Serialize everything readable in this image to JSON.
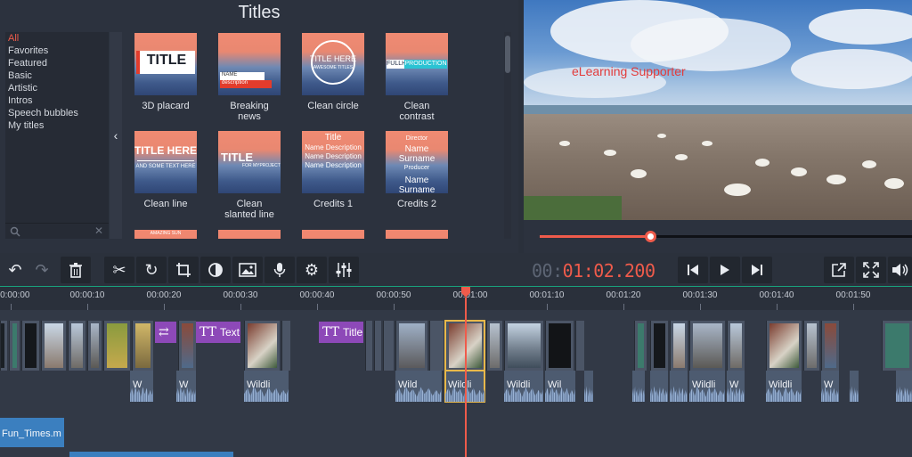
{
  "titles_panel": {
    "heading": "Titles",
    "categories": [
      "All",
      "Favorites",
      "Featured",
      "Basic",
      "Artistic",
      "Intros",
      "Speech bubbles",
      "My titles"
    ],
    "tiles": [
      {
        "label": "3D placard",
        "art_text": "TITLE",
        "sub_text": ""
      },
      {
        "label": "Breaking\nnews",
        "art_text": "NAME",
        "sub_text": "description"
      },
      {
        "label": "Clean circle",
        "art_text": "TITLE HERE",
        "sub_text": "AWESOME TITLES"
      },
      {
        "label": "Clean\ncontrast",
        "art_text": "FULLHD",
        "sub_text": "PRODUCTION"
      },
      {
        "label": "Clean line",
        "art_text": "TITLE HERE",
        "sub_text": "AND SOME TEXT HERE"
      },
      {
        "label": "Clean\nslanted line",
        "art_text": "TITLE",
        "sub_text": "FOR MYPROJECT"
      },
      {
        "label": "Credits 1",
        "art_text": "Title",
        "sub_text": "Name Description"
      },
      {
        "label": "Credits 2",
        "art_text": "Director",
        "sub_text": "Name Surname"
      }
    ],
    "credits1_lines": [
      "Title",
      "Name Description",
      "Name Description",
      "Name Description"
    ],
    "credits2_lines": [
      "Director",
      "Name Surname",
      "Producer",
      "Name Surname"
    ],
    "peek_tile_text": "AMAZING SUN"
  },
  "preview": {
    "watermark": "eLearning Supporter",
    "progress": 0.297
  },
  "timecode": {
    "dim": "00:",
    "hot": "01:02.200"
  },
  "toolbar": {
    "left_icons": [
      "undo-icon",
      "redo-icon",
      "trash-icon",
      "cut-icon",
      "rotate-icon",
      "crop-icon",
      "color-adjust-icon",
      "image-icon",
      "microphone-icon",
      "settings-icon",
      "equalizer-icon"
    ],
    "right_icons": [
      "skip-back-icon",
      "play-icon",
      "skip-forward-icon",
      "export-icon",
      "fullscreen-icon",
      "volume-icon"
    ]
  },
  "ruler": {
    "labels": [
      "00:00:00",
      "00:00:10",
      "00:00:20",
      "00:00:30",
      "00:00:40",
      "00:00:50",
      "00:01:00",
      "00:01:10",
      "00:01:20",
      "00:01:30",
      "00:01:40",
      "00:01:50"
    ]
  },
  "timeline": {
    "title_clips": [
      {
        "label": ""
      },
      {
        "label": "Text"
      },
      {
        "label": "Title"
      }
    ],
    "audio_labels": [
      "W",
      "W",
      "Wildli",
      "Wild",
      "Wildli",
      "Wildli",
      "Wil",
      "Wildli",
      "W",
      "Wildli",
      "W"
    ],
    "music_clip": "Fun_Times.m"
  },
  "colors": {
    "accent": "#ef5b4b",
    "title_clip": "#8d49b8",
    "music": "#3b7fbf",
    "selection": "#e8b84a"
  }
}
